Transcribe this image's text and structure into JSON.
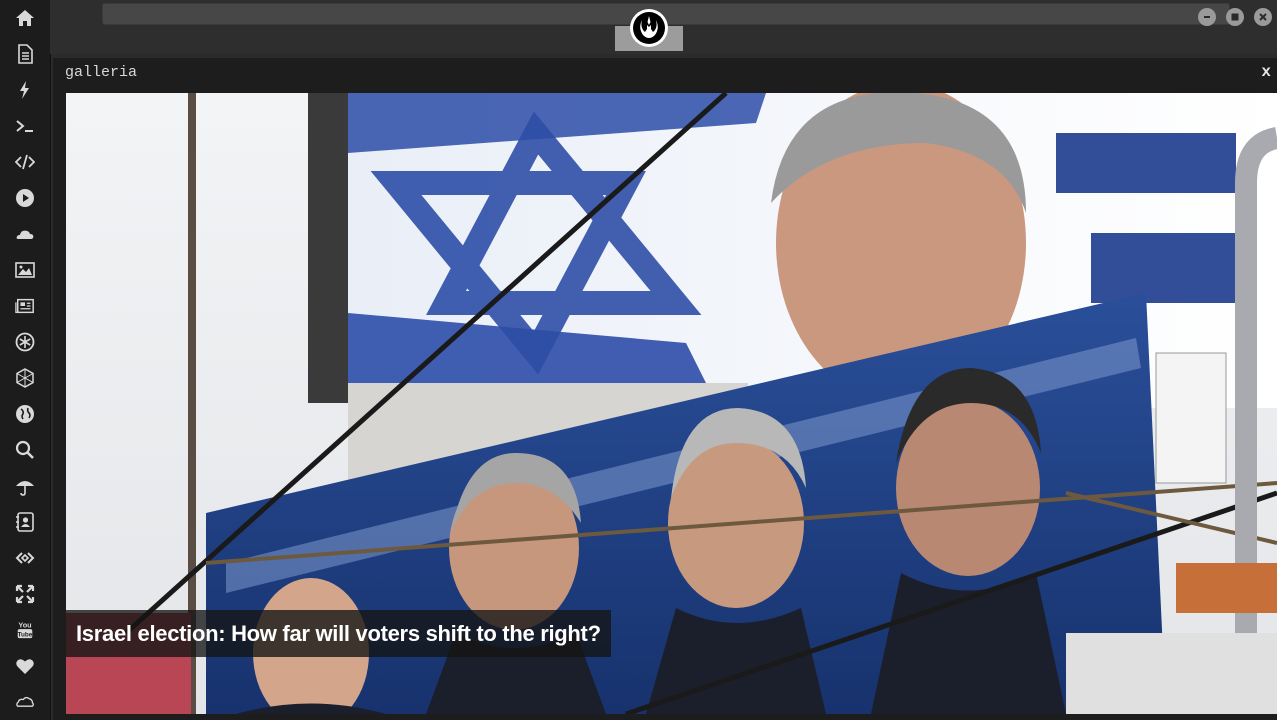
{
  "window": {
    "logo_icon": "rebel-alliance-icon",
    "controls": {
      "minimize_icon": "minimize-icon",
      "maximize_icon": "maximize-icon",
      "close_icon": "close-icon"
    }
  },
  "sidebar": {
    "items": [
      {
        "icon": "home-icon"
      },
      {
        "icon": "document-icon"
      },
      {
        "icon": "lightning-icon"
      },
      {
        "icon": "terminal-icon"
      },
      {
        "icon": "code-icon"
      },
      {
        "icon": "play-icon"
      },
      {
        "icon": "cloud-icon"
      },
      {
        "icon": "image-icon"
      },
      {
        "icon": "newspaper-icon"
      },
      {
        "icon": "aperture-icon"
      },
      {
        "icon": "hexagon-icon"
      },
      {
        "icon": "globe-icon"
      },
      {
        "icon": "search-icon"
      },
      {
        "icon": "umbrella-icon"
      },
      {
        "icon": "contact-card-icon"
      },
      {
        "icon": "link-icon"
      },
      {
        "icon": "expand-icon"
      },
      {
        "icon": "youtube-icon"
      },
      {
        "icon": "heart-icon"
      },
      {
        "icon": "cloud-outline-icon"
      }
    ]
  },
  "panel": {
    "title": "galleria",
    "close_label": "x",
    "caption": "Israel election: How far will voters shift to the right?"
  },
  "colors": {
    "sidebar_bg": "#1c1c1c",
    "panel_bg": "#1d1d1d",
    "icon": "#d9d9d9"
  }
}
